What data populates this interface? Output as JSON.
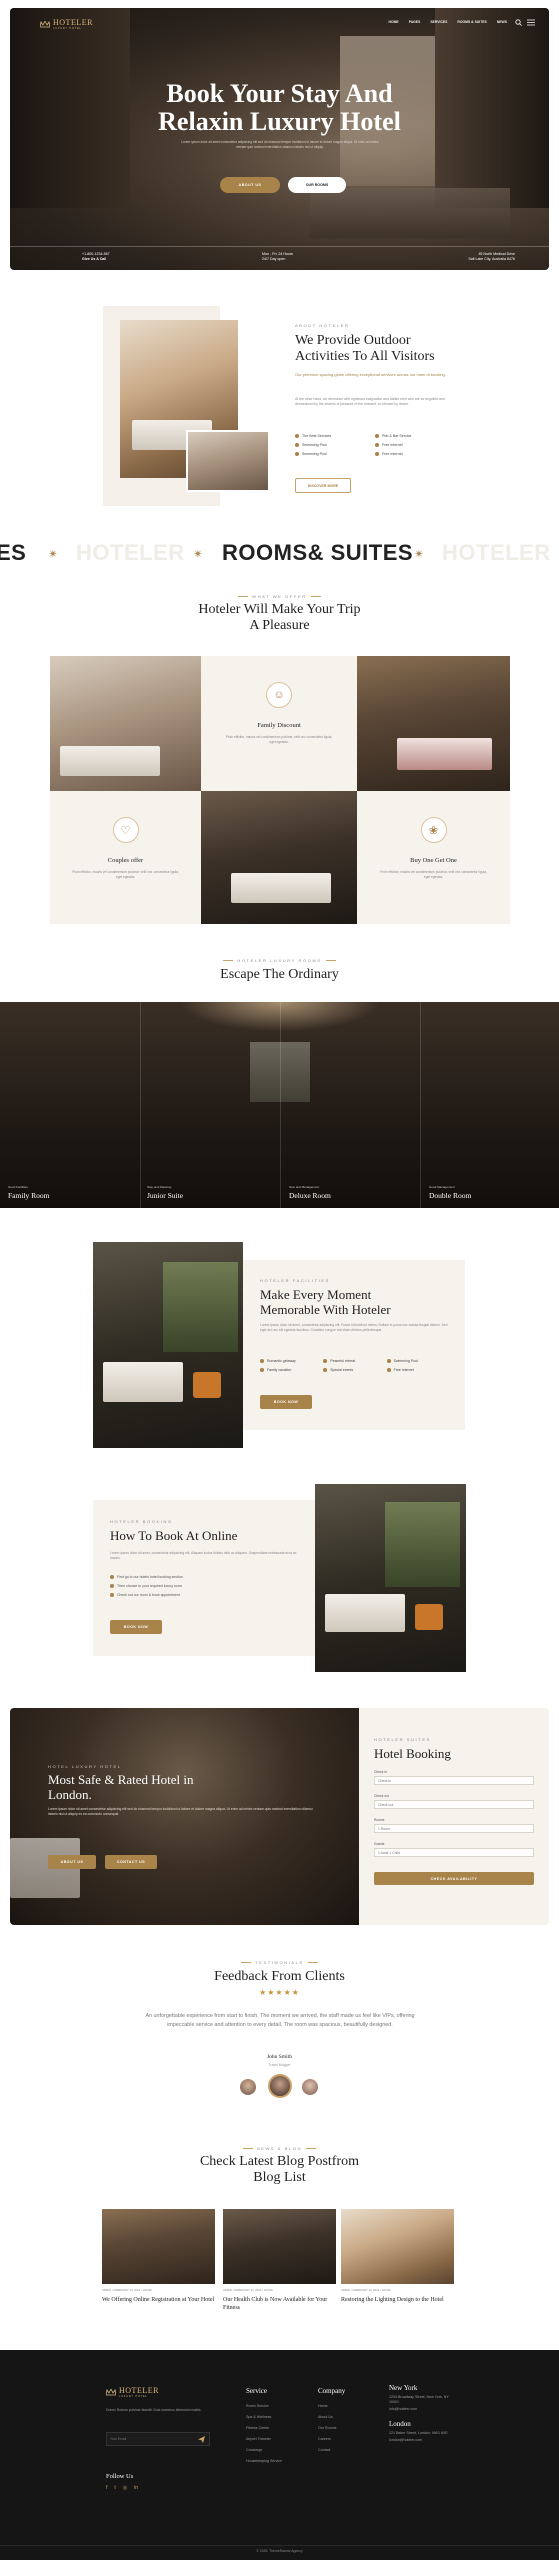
{
  "brand": {
    "name": "HOTELER",
    "tagline": "LUXURY HOTEL"
  },
  "nav": {
    "items": [
      "HOME",
      "PAGES",
      "SERVICES",
      "ROOMS & SUITES",
      "NEWS"
    ]
  },
  "hero": {
    "title_line1": "Book Your Stay And",
    "title_line2": "Relaxin Luxury Hotel",
    "lede": "Lorem ipsum dolor sit amet consectetur adipiscing elit sed do eiusmod tempor incididunt ut labore et dolore magna aliqua. Ut enim ad minim veniam quis nostrud exercitation ullamco laboris nisi ut aliquip.",
    "btn_about": "ABOUT US",
    "btn_rooms": "OUR ROOMS",
    "info": [
      {
        "line1": "+1-800-1234-567",
        "line2": "Give Us A Call"
      },
      {
        "line1": "Mon - Fri: 24 Hours",
        "line2": "24/7 Day open"
      },
      {
        "line1": "45 North Medical Drive",
        "line2": "Salt Lake City, Australia 8476"
      }
    ]
  },
  "about": {
    "eyebrow": "ABOUT HOTELER",
    "title_line1": "We Provide Outdoor",
    "title_line2": "Activities To All Visitors",
    "highlight": "Our premium spacing globe offering exceptional services across our hotel of booking.",
    "body": "At the other hand, we denounce with righteous indignation and dislike men who are so beguiled and demoralized by the charms of pleasure of the moment, so blinded by desire.",
    "features": [
      "The Best Services",
      "Pub & Bar Service",
      "Swimming Pool",
      "Free Internet",
      "Swimming Pool",
      "Free Internet"
    ],
    "btn": "DISCOVER MORE"
  },
  "marquee": {
    "words": [
      "ES",
      "HOTELER",
      "ROOMS& SUITES",
      "HOTELER"
    ]
  },
  "offers": {
    "eyebrow": "WHAT WE OFFER",
    "title_line1": "Hoteler Will Make Your Trip",
    "title_line2": "A Pleasure",
    "cards": [
      {
        "title": "Family Discount",
        "text": "Proin efficitur, mauris vel condimentum pulvinar, velit orci consectetur ligula, eget egestas."
      },
      {
        "title": "Couples offer",
        "text": "Proin efficitur, mauris vel condimentum pulvinar, velit orci consectetur ligula, eget egestas."
      },
      {
        "title": "Buy One Get One",
        "text": "Proin efficitur, mauris vel condimentum pulvinar, velit orci consectetur ligula, eget egestas."
      }
    ]
  },
  "rooms": {
    "eyebrow": "HOTELER LUXURY ROOMS",
    "title": "Escape The Ordinary",
    "items": [
      {
        "tag": "Good Facilities",
        "name": "Family Room"
      },
      {
        "tag": "Stay and Relaxing",
        "name": "Junior Suite"
      },
      {
        "tag": "Nice and Management",
        "name": "Deluxe Room"
      },
      {
        "tag": "Good Management",
        "name": "Double Room"
      }
    ]
  },
  "memorable": {
    "eyebrow": "HOTELER FACILITIES",
    "title_line1": "Make Every Moment",
    "title_line2": "Memorable With Hoteler",
    "body": "Lorem ipsum dolor sit amet, consectetur adipiscing elit. Fusce id tincidunt metus. Nullam in purus nec massa feugiat dictum. Sed eget dui nec elit egestas faucibus. Curabitur congue nisi vitae ultricies pellentesque.",
    "features": [
      "Romantic getaway",
      "Peaceful retreat",
      "Swimming Pool",
      "Family vacation",
      "Special events",
      "Free Internet"
    ],
    "btn": "BOOK NOW"
  },
  "howto": {
    "eyebrow": "HOTELER BOOKING",
    "title": "How To Book At Online",
    "body": "Lorem ipsum dolor sit amet, consectetur adipiscing elit. Aliquam luctus finibus nibh ac aliquam. Suspendisse malesuada eros ac mauris.",
    "steps": [
      "First go to our hotels hotel booking section",
      "Then choose to your required luxury room",
      "Check out our room & book appointment"
    ],
    "btn": "BOOK NOW"
  },
  "booking_hero": {
    "eyebrow": "HOTEL LUXURY HOTEL",
    "title_line1": "Most Safe & Rated Hotel in",
    "title_line2": "London.",
    "body": "Lorem ipsum dolor sit amet consectetur adipiscing elit sed do eiusmod tempor incididunt ut labore et dolore magna aliqua. Ut enim ad minim veniam quis nostrud exercitation ullamco laboris nisi ut aliquip ex ea commodo consequat.",
    "btn_about": "ABOUT US",
    "btn_contact": "CONTACT US"
  },
  "booking_form": {
    "eyebrow": "HOTELER SUITES",
    "title": "Hotel Booking",
    "fields": [
      {
        "label": "Check in",
        "placeholder": "Check in"
      },
      {
        "label": "Check out",
        "placeholder": "Check out"
      },
      {
        "label": "Rooms",
        "placeholder": "1 Room"
      },
      {
        "label": "Guests",
        "placeholder": "1 Adult 1 Child"
      }
    ],
    "submit": "CHECK AVAILABILITY"
  },
  "testimonials": {
    "eyebrow": "TESTIMONIALS",
    "title": "Feedback From Clients",
    "stars": 5,
    "quote": "An unforgettable experience from start to finish. The moment we arrived, the staff made us feel like VIPs, offering impeccable service and attention to every detail. The room was spacious, beautifully designed.",
    "name": "John Smith",
    "role": "Travel Blogger"
  },
  "blog": {
    "eyebrow": "NEWS & BLOG",
    "title_line1": "Check Latest Blog Postfrom",
    "title_line2": "Blog List",
    "posts": [
      {
        "meta": "ADMIN  •  FEBRUARY 14, 2024  •  HOTEL",
        "title": "We Offering Online Registration at Your Hotel"
      },
      {
        "meta": "ADMIN  •  FEBRUARY 14, 2024  •  HOTEL",
        "title": "Our Health Club is Now Available for Your Fitness"
      },
      {
        "meta": "ADMIN  •  FEBRUARY 14, 2024  •  HOTEL",
        "title": "Restoring the Lighting Design to the Hotel"
      }
    ]
  },
  "footer": {
    "about": "Donec Rutrum pulvinar blandit. Duis maximus bibendum mattis.",
    "email_placeholder": "Your Email",
    "follow": "Follow Us",
    "service_title": "Service",
    "service_links": [
      "Room Service",
      "Spa & Wellness",
      "Fitness Center",
      "Airport Transfer",
      "Concierge",
      "Housekeeping Service"
    ],
    "company_title": "Company",
    "company_links": [
      "Home",
      "About Us",
      "Our Rooms",
      "Careers",
      "Contact"
    ],
    "ny_title": "New York",
    "ny_address": "1234 Broadway Street, New York, NY 10001",
    "ny_email": "info@hoteler.com",
    "london_title": "London",
    "london_address": "221 Baker Street, London, NW1 6XE",
    "london_email": "london@hoteler.com",
    "copyright": "© 2025, ThemeRasme Agency"
  }
}
